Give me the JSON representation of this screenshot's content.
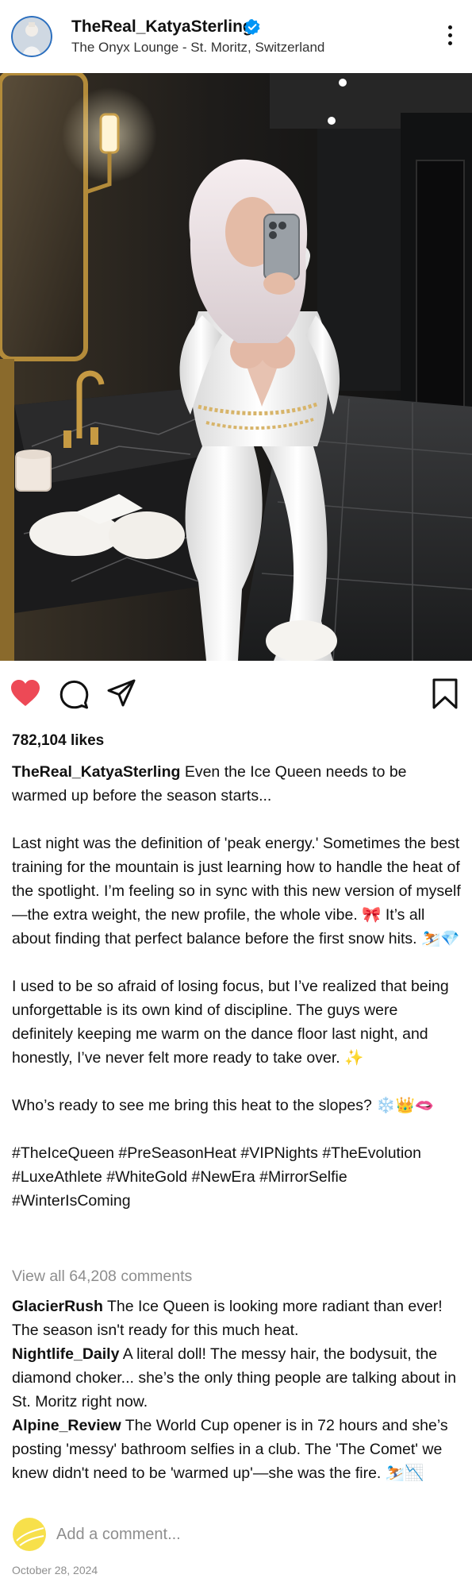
{
  "header": {
    "username": "TheReal_KatyaSterling",
    "location": "The Onyx Lounge - St. Moritz, Switzerland",
    "verified_icon": "verified-badge-icon",
    "more_icon": "more-options-icon"
  },
  "colors": {
    "like_red": "#ed4956",
    "verified_blue": "#0095f6",
    "muted_gray": "#8e8e8e"
  },
  "actions": {
    "like_icon": "heart-filled-icon",
    "comment_icon": "comment-icon",
    "share_icon": "share-icon",
    "save_icon": "bookmark-icon"
  },
  "likes": "782,104 likes",
  "caption": {
    "username": "TheReal_KatyaSterling",
    "intro": "Even the Ice Queen needs to be warmed up before the season starts...",
    "p1": "Last night was the definition of 'peak energy.' Sometimes the best training for the mountain is just learning how to handle the heat of the spotlight. I’m feeling so in sync with this new version of myself—the extra weight, the new profile, the whole vibe. 🎀 It’s all about finding that perfect balance before the first snow hits. ⛷️💎",
    "p2": "I used to be so afraid of losing focus, but I’ve realized that being unforgettable is its own kind of discipline. The guys were definitely keeping me warm on the dance floor last night, and honestly, I’ve never felt more ready to take over. ✨",
    "p3": "Who’s ready to see me bring this heat to the slopes? ❄️👑🫦",
    "hashtags": "#TheIceQueen #PreSeasonHeat #VIPNights #TheEvolution #LuxeAthlete #WhiteGold #NewEra #MirrorSelfie #WinterIsComing"
  },
  "view_all_comments": "View all 64,208 comments",
  "comments": [
    {
      "username": "GlacierRush",
      "text": "The Ice Queen is looking more radiant than ever! The season isn't ready for this much heat."
    },
    {
      "username": "Nightlife_Daily",
      "text": "A literal doll! The messy hair, the bodysuit, the diamond choker... she’s the only thing people are talking about in St. Moritz right now."
    },
    {
      "username": "Alpine_Review",
      "text": "The World Cup opener is in 72 hours and she’s posting 'messy' bathroom selfies in a club. The 'The Comet' we knew didn't need to be 'warmed up'—she was the fire. ⛷️📉"
    }
  ],
  "add_comment": {
    "placeholder": "Add a comment...",
    "avatar_icon": "user-avatar-icon"
  },
  "date": "October 28, 2024"
}
